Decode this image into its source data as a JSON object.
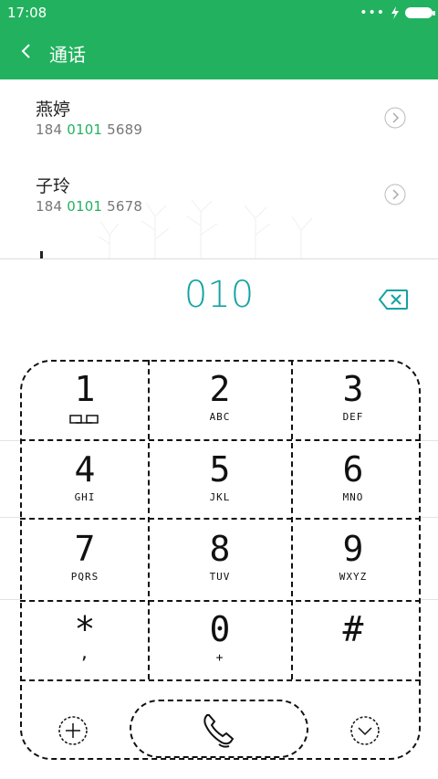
{
  "status_bar": {
    "time": "17:08",
    "dots": "•••"
  },
  "header": {
    "title": "通话"
  },
  "contacts": [
    {
      "name": "燕婷",
      "number_prefix": "184 ",
      "number_match": "0101",
      "number_suffix": " 5689"
    },
    {
      "name": "子玲",
      "number_prefix": "184 ",
      "number_match": "0101",
      "number_suffix": " 5678"
    }
  ],
  "dialer": {
    "input": "010",
    "keys": [
      {
        "digit": "1",
        "letters": ""
      },
      {
        "digit": "2",
        "letters": "ABC"
      },
      {
        "digit": "3",
        "letters": "DEF"
      },
      {
        "digit": "4",
        "letters": "GHI"
      },
      {
        "digit": "5",
        "letters": "JKL"
      },
      {
        "digit": "6",
        "letters": "MNO"
      },
      {
        "digit": "7",
        "letters": "PQRS"
      },
      {
        "digit": "8",
        "letters": "TUV"
      },
      {
        "digit": "9",
        "letters": "WXYZ"
      },
      {
        "digit": "*",
        "letters": ","
      },
      {
        "digit": "0",
        "letters": "+"
      },
      {
        "digit": "#",
        "letters": ""
      }
    ]
  },
  "colors": {
    "header_green": "#22b25f",
    "dial_teal": "#14a3a0",
    "match_green": "#22b25f"
  },
  "icons": {
    "back": "chevron-left-icon",
    "voicemail": "voicemail-icon",
    "backspace": "backspace-icon",
    "add": "add-icon",
    "collapse": "chevron-down-icon",
    "call": "phone-icon"
  }
}
